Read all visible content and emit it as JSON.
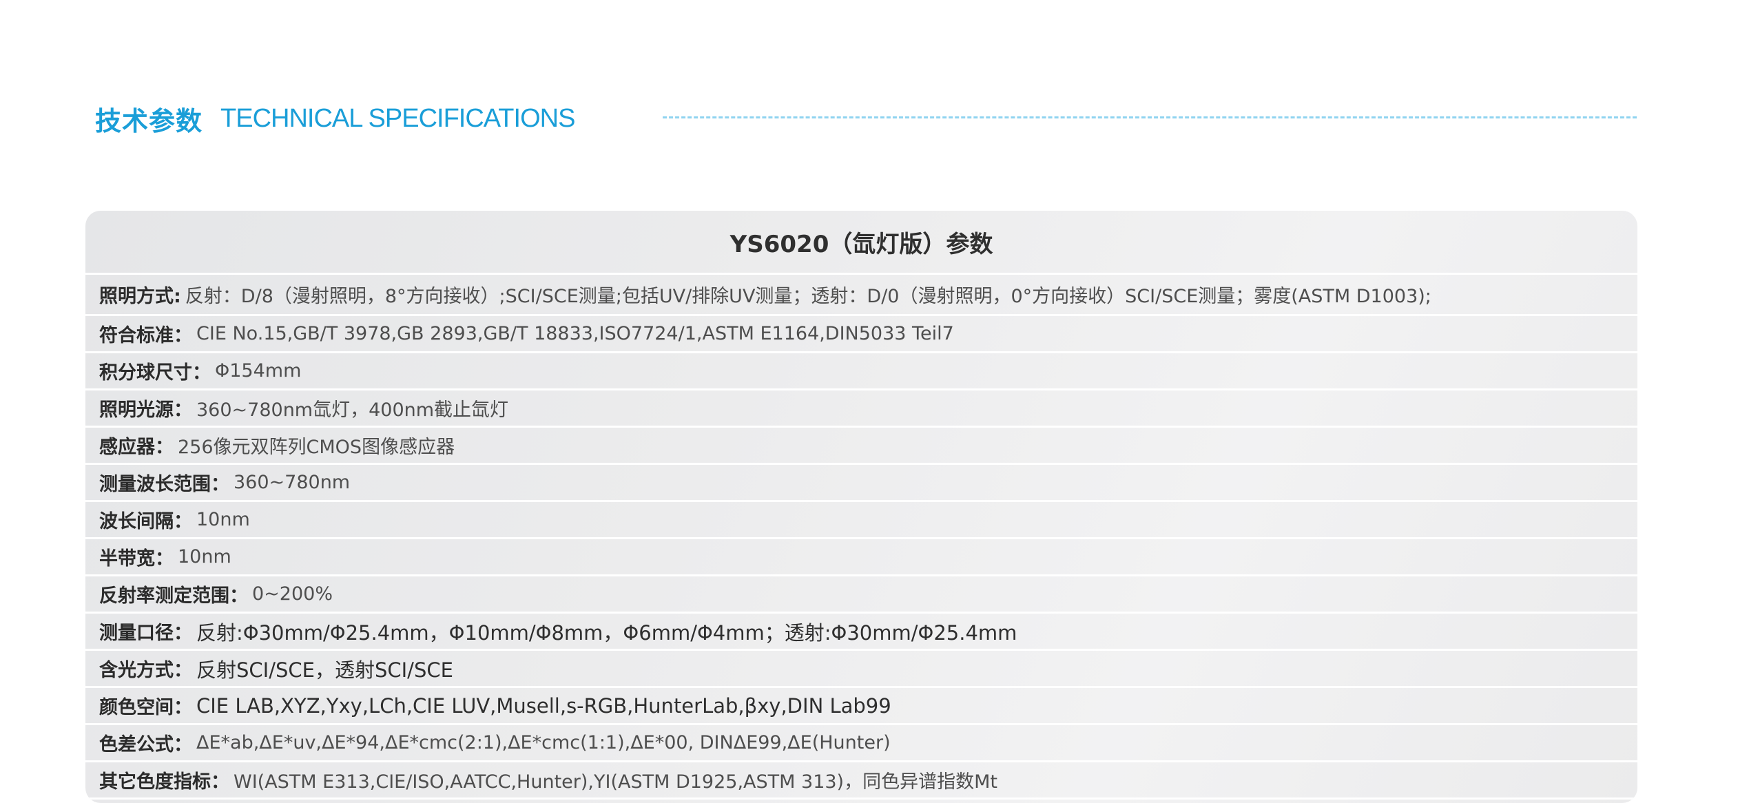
{
  "header": {
    "title_cn": "技术参数",
    "title_en": "TECHNICAL SPECIFICATIONS"
  },
  "spec_table": {
    "title": "YS6020（氙灯版）参数",
    "rows": [
      {
        "label": "照明方式:",
        "value": "反射：D/8（漫射照明，8°方向接收）;SCI/SCE测量;包括UV/排除UV测量；透射：D/0（漫射照明，0°方向接收）SCI/SCE测量；雾度(ASTM D1003);"
      },
      {
        "label": "符合标准：",
        "value": "CIE No.15,GB/T 3978,GB 2893,GB/T 18833,ISO7724/1,ASTM E1164,DIN5033 Teil7"
      },
      {
        "label": "积分球尺寸：",
        "value": "Φ154mm"
      },
      {
        "label": "照明光源：",
        "value": "360~780nm氙灯，400nm截止氙灯"
      },
      {
        "label": "感应器：",
        "value": "256像元双阵列CMOS图像感应器"
      },
      {
        "label": "测量波长范围：",
        "value": "360~780nm"
      },
      {
        "label": "波长间隔：",
        "value": "10nm"
      },
      {
        "label": "半带宽：",
        "value": "10nm"
      },
      {
        "label": "反射率测定范围：",
        "value": "0~200%"
      },
      {
        "label": "测量口径：",
        "value": "反射:Φ30mm/Φ25.4mm，Φ10mm/Φ8mm，Φ6mm/Φ4mm；透射:Φ30mm/Φ25.4mm"
      },
      {
        "label": "含光方式：",
        "value": "反射SCI/SCE，透射SCI/SCE"
      },
      {
        "label": "颜色空间：",
        "value": "CIE LAB,XYZ,Yxy,LCh,CIE LUV,Musell,s-RGB,HunterLab,βxy,DIN Lab99"
      },
      {
        "label": "色差公式：",
        "value": "ΔE*ab,ΔE*uv,ΔE*94,ΔE*cmc(2:1),ΔE*cmc(1:1),ΔE*00, DINΔE99,ΔE(Hunter)"
      },
      {
        "label": "其它色度指标：",
        "value": "WI(ASTM E313,CIE/ISO,AATCC,Hunter),YI(ASTM D1925,ASTM 313)，同色异谱指数Mt"
      }
    ]
  },
  "colors": {
    "accent": "#1a9ed8",
    "dash": "#8fd3f0",
    "card_bg": "#ececed"
  }
}
